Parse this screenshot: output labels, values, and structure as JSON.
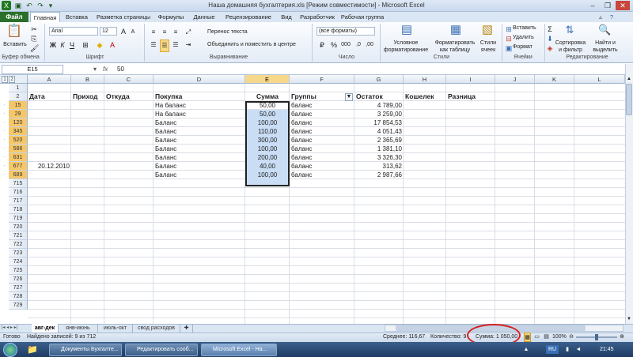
{
  "window": {
    "title": "Наша домашняя бухгалтерия.xls  [Режим совместимости]  -  Microsoft Excel"
  },
  "tabs": [
    "Файл",
    "Главная",
    "Вставка",
    "Разметка страницы",
    "Формулы",
    "Данные",
    "Рецензирование",
    "Вид",
    "Разработчик",
    "Рабочая группа"
  ],
  "ribbon": {
    "clipboard": {
      "paste": "Вставить",
      "group": "Буфер обмена"
    },
    "font": {
      "name": "Arial",
      "size": "12",
      "group": "Шрифт"
    },
    "align": {
      "wrap": "Перенос текста",
      "merge": "Объединить и поместить в центре",
      "group": "Выравнивание"
    },
    "number": {
      "format": "(все форматы)",
      "group": "Число"
    },
    "styles": {
      "conditional": "Условное форматирование",
      "as_table": "Форматировать как таблицу",
      "cell_styles": "Стили ячеек",
      "group": "Стили"
    },
    "cells": {
      "insert": "Вставить",
      "delete": "Удалить",
      "format": "Формат",
      "group": "Ячейки"
    },
    "editing": {
      "sort": "Сортировка и фильтр",
      "find": "Найти и выделить",
      "group": "Редактирование"
    }
  },
  "formula_bar": {
    "name_box": "E15",
    "fx": "fx",
    "value": "50"
  },
  "columns": [
    "A",
    "B",
    "C",
    "D",
    "E",
    "F",
    "G",
    "H",
    "I",
    "J",
    "K",
    "L"
  ],
  "header_row": {
    "row": "2",
    "cells": [
      "Дата",
      "Приход",
      "Откуда",
      "Покупка",
      "Сумма",
      "Группы",
      "Остаток",
      "Кошелек",
      "Разница"
    ]
  },
  "row1": "1",
  "rows": [
    {
      "n": "15",
      "date": "",
      "buy": "На баланс",
      "sum": "50,00",
      "group": "баланс",
      "rest": "4 789,00"
    },
    {
      "n": "29",
      "date": "",
      "buy": "На баланс",
      "sum": "50,00",
      "group": "баланс",
      "rest": "3 259,00"
    },
    {
      "n": "120",
      "date": "",
      "buy": "Баланс",
      "sum": "100,00",
      "group": "баланс",
      "rest": "17 854,53"
    },
    {
      "n": "345",
      "date": "",
      "buy": "Баланс",
      "sum": "110,00",
      "group": "баланс",
      "rest": "4 051,43"
    },
    {
      "n": "520",
      "date": "",
      "buy": "Баланс",
      "sum": "300,00",
      "group": "баланс",
      "rest": "2 365,69"
    },
    {
      "n": "586",
      "date": "",
      "buy": "Баланс",
      "sum": "100,00",
      "group": "баланс",
      "rest": "1 381,10"
    },
    {
      "n": "631",
      "date": "",
      "buy": "Баланс",
      "sum": "200,00",
      "group": "баланс",
      "rest": "3 326,30"
    },
    {
      "n": "677",
      "date": "20.12.2010",
      "buy": "Баланс",
      "sum": "40,00",
      "group": "баланс",
      "rest": "313,62"
    },
    {
      "n": "689",
      "date": "",
      "buy": "Баланс",
      "sum": "100,00",
      "group": "баланс",
      "rest": "2 987,66"
    }
  ],
  "empty_rows": [
    "715",
    "716",
    "717",
    "718",
    "719",
    "720",
    "721",
    "722",
    "723",
    "724",
    "725",
    "726",
    "727",
    "728",
    "729"
  ],
  "sheets": [
    "авг-дек",
    "янв-июнь",
    "июль-окт",
    "свод расходов"
  ],
  "status": {
    "ready": "Готово",
    "found": "Найдено записей: 9 из 712",
    "average": "Среднее: 116,67",
    "count": "Количество: 9",
    "sum": "Сумма: 1 050,00",
    "zoom": "100%"
  },
  "taskbar": {
    "items": [
      "Документы Бухгалте...",
      "Редактировать сооб...",
      "Microsoft Excel - На..."
    ],
    "lang": "RU",
    "time": "21:45"
  }
}
